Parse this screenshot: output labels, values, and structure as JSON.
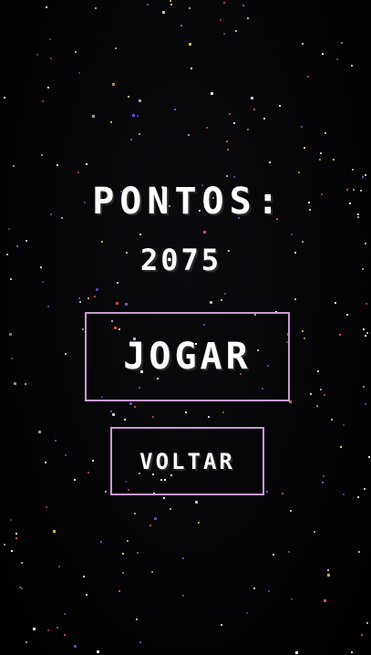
{
  "score": {
    "label": "PONTOS:",
    "value": "2075"
  },
  "buttons": {
    "play_label": "JOGAR",
    "back_label": "VOLTAR"
  },
  "colors": {
    "background": "#000000",
    "text": "#ffffff",
    "button_border": "#c99bd1",
    "star_palette": [
      "#ffffff",
      "#f2c14e",
      "#e2523a",
      "#6b5bd6",
      "#ffffff",
      "#ffffff"
    ]
  }
}
